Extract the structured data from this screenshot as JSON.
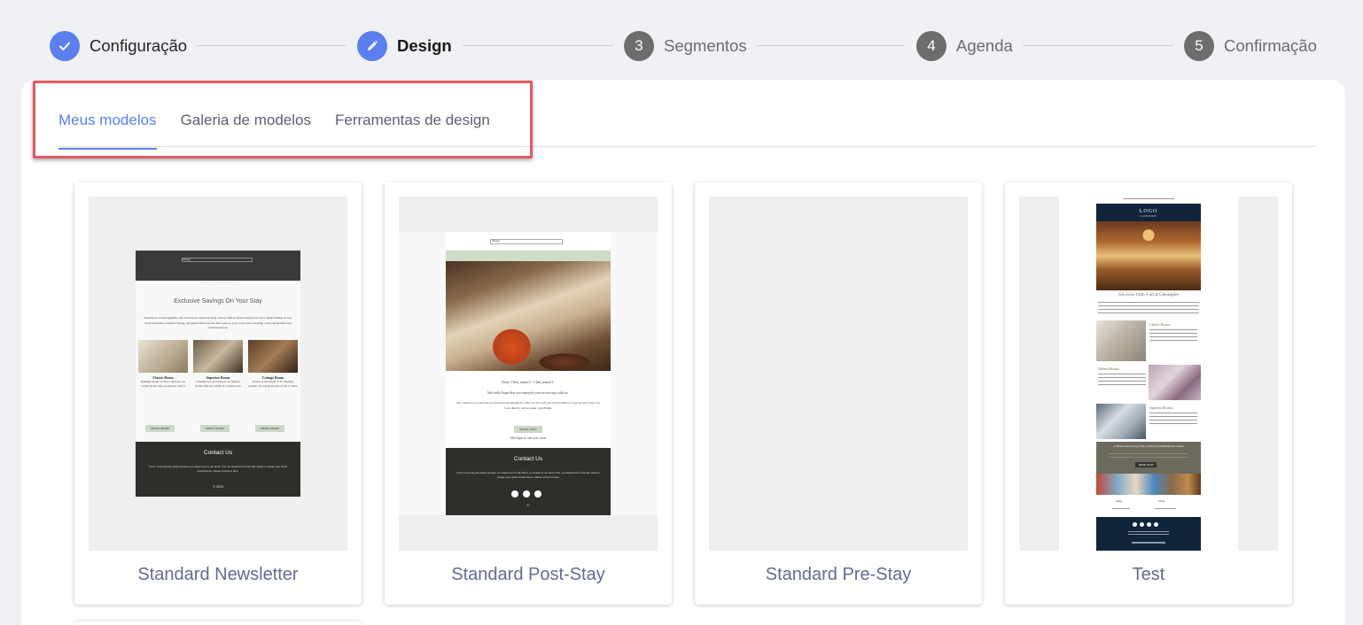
{
  "stepper": {
    "steps": [
      {
        "number": "",
        "label": "Configuração",
        "state": "done"
      },
      {
        "number": "",
        "label": "Design",
        "state": "current"
      },
      {
        "number": "3",
        "label": "Segmentos",
        "state": "pending"
      },
      {
        "number": "4",
        "label": "Agenda",
        "state": "pending"
      },
      {
        "number": "5",
        "label": "Confirmação",
        "state": "pending"
      }
    ]
  },
  "tabs": [
    {
      "label": "Meus modelos",
      "active": true
    },
    {
      "label": "Galeria de modelos",
      "active": false
    },
    {
      "label": "Ferramentas de design",
      "active": false
    }
  ],
  "templates": [
    {
      "name": "Standard Newsletter",
      "preview": {
        "top_bar": "Image",
        "nav": [
          "Home",
          "Book Now"
        ],
        "heading": "Exclusive Savings On Your Stay",
        "intro": "Experience an unforgettable stay in the heart luxurious hotel, where comfort meets elegance in every detail. Indulge in top-notch amenities, exquisite dining, and unparalleled service that caters to your every need, ensuring a truly memorable and opulent getaway.",
        "rooms": [
          {
            "title": "Classic Room",
            "text": "Strikingly simple yet full of character, our Classic Rooms offer exceptional comfort",
            "button": "SHOW MORE"
          },
          {
            "title": "Superior Room",
            "text": "Contemporary yet luxurious, our Superior Rooms offer the comfort of a double room",
            "button": "SHOW MORE"
          },
          {
            "title": "Cottage Room",
            "text": "Situated at the bottom of our charming gardens, our Cottage Rooms are full of charm",
            "button": "SHOW MORE"
          }
        ],
        "footer_title": "Contact Us",
        "footer_text": "You're receiving this email because you signed up for our hotel. You can unsubscribe from this email or change your email notifications. Online version is here.",
        "copyright": "© 2024"
      }
    },
    {
      "name": "Standard Post-Stay",
      "preview": {
        "top_bar": "Image",
        "nav": [
          "Home",
          "Book Now"
        ],
        "greeting": "Dear {{first_name}} {{last_name}},",
        "text1": "We really hope that you enjoyed your recent stay with us.",
        "text2": "We would love to welcome you back and are delighted to offer you 10% off your next booking as a special treat when you book directly with us using code BOOK",
        "button": "BOOK NOW",
        "sign_off": "We hope to see you soon",
        "footer_title": "Contact Us",
        "footer_text": "You're receiving this email because you signed up for the Hotel, or booked at our hotel. You can unsubscribe from this email or change your email notifications. Online version is here.",
        "copyright": "©"
      }
    },
    {
      "name": "Standard Pre-Stay",
      "preview": {}
    },
    {
      "name": "Test",
      "preview": {
        "logo": "LOGO",
        "logo_sub": "LONDON",
        "heading": "Get away from it all at Gleneagles",
        "rooms": [
          "Classic Rooms",
          "Deluxe Rooms",
          "Superior Rooms"
        ],
        "banner": "A Stone's throw away from a world of possibilities in London",
        "banner_button": "BOOK NOW",
        "contact_items": [
          "Image",
          "Image"
        ]
      }
    }
  ],
  "colors": {
    "accent": "#5b7fee",
    "pending_step": "#6d6d6d",
    "highlight": "#e05a63",
    "template_name": "#646b8f"
  }
}
